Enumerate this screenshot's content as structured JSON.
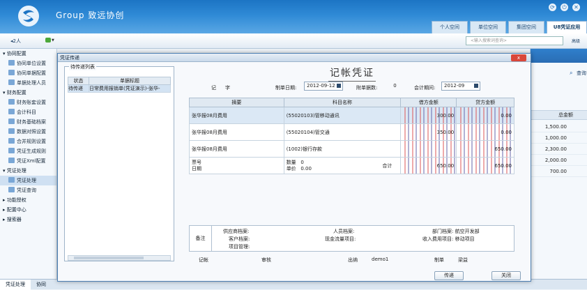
{
  "header": {
    "brand": "Group  致远协创",
    "tabs": [
      "个人空间",
      "单位空间",
      "集团空间",
      "U8凭证应用"
    ]
  },
  "toolbar": {
    "users": "2人",
    "search_placeholder": "<输入搜索词查询>",
    "search_btn": "高级"
  },
  "sidebar": {
    "groups": [
      {
        "label": "协同配置",
        "items": [
          "协同单位设置",
          "协同单据配置",
          "单据处理人员"
        ]
      },
      {
        "label": "财务配置",
        "items": [
          "财务账套设置",
          "会计科目",
          "财务基础档案",
          "数据对照设置",
          "合并规则设置",
          "凭证生成规则",
          "凭证Xml配置"
        ]
      },
      {
        "label": "凭证处理",
        "items": [
          "凭证处理",
          "凭证查询"
        ]
      },
      {
        "label": "功能授权",
        "items": []
      },
      {
        "label": "配置中心",
        "items": []
      },
      {
        "label": "搜索器",
        "items": []
      }
    ]
  },
  "status": {
    "tabs": [
      "凭证处理",
      "协同"
    ]
  },
  "right": {
    "query": "查询",
    "col": "总金额",
    "values": [
      "1,500.00",
      "1,000.00",
      "2,300.00",
      "2,000.00",
      "700.00"
    ]
  },
  "dialog": {
    "title": "凭证传递",
    "close": "x",
    "pending": {
      "label": "待传递列表",
      "headers": [
        "状态",
        "单据标题"
      ],
      "rows": [
        [
          "待传递",
          "日常费用报销单(凭证演示)-张华-"
        ]
      ]
    },
    "voucher": {
      "title": "记帐凭证",
      "type_label": "记",
      "type_suffix": "字",
      "date_label": "制单日期:",
      "date": "2012-09-12",
      "attach_label": "附单据数:",
      "attach": "0",
      "period_label": "会计期间:",
      "period": "2012-09",
      "headers": [
        "摘要",
        "科目名称",
        "借方金额",
        "贷方金额"
      ],
      "rows": [
        {
          "summary": "张华报08月费用",
          "account": "(55020103)管移动通讯",
          "debit": "300.00",
          "credit": "0.00"
        },
        {
          "summary": "张华报08月费用",
          "account": "(55020104)管交通",
          "debit": "350.00",
          "credit": "0.00"
        },
        {
          "summary": "张华报08月费用",
          "account": "(1002)银行存款",
          "debit": "",
          "credit": "650.00"
        }
      ],
      "total": {
        "voucher_no": "票号",
        "date": "日期",
        "qty_label": "数量",
        "qty": "0",
        "price_label": "单价",
        "price": "0.00",
        "label": "合计",
        "debit": "650.00",
        "credit": "650.00"
      },
      "footer": {
        "note": "备注",
        "supplier": "供应商档案:",
        "person": "人员档案:",
        "dept": "部门档案: 航空开发部",
        "customer": "客户档案:",
        "cashflow": "现金流量项目:",
        "income": "收入费用项目: 移动项目",
        "project": "项目管理:"
      },
      "sign": {
        "bookkeep": "记帐",
        "audit": "审核",
        "cashier": "出纳",
        "cashier_name": "demo1",
        "maker": "制单",
        "maker_name": "梁益"
      }
    },
    "buttons": {
      "send": "传递",
      "close": "关闭"
    }
  }
}
